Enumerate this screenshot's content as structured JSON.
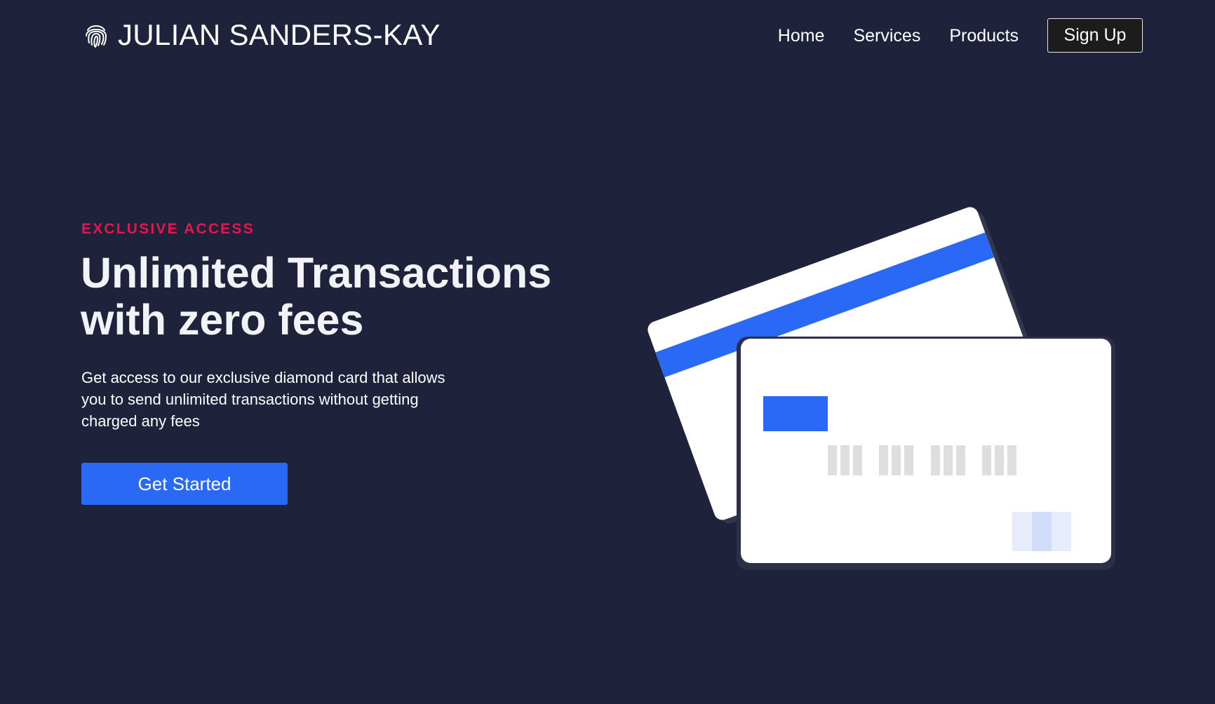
{
  "brand": {
    "name": "JULIAN SANDERS-KAY",
    "icon": "fingerprint-icon"
  },
  "nav": {
    "links": [
      "Home",
      "Services",
      "Products"
    ],
    "signup_label": "Sign Up"
  },
  "hero": {
    "eyebrow": "EXCLUSIVE ACCESS",
    "headline_line1": "Unlimited Transactions",
    "headline_line2": "with zero fees",
    "description": "Get access to our exclusive diamond card that allows you to send unlimited transactions without getting charged any fees",
    "cta_label": "Get Started"
  },
  "colors": {
    "background": "#1e223a",
    "accent": "#2969f5",
    "eyebrow": "#e5164e"
  }
}
